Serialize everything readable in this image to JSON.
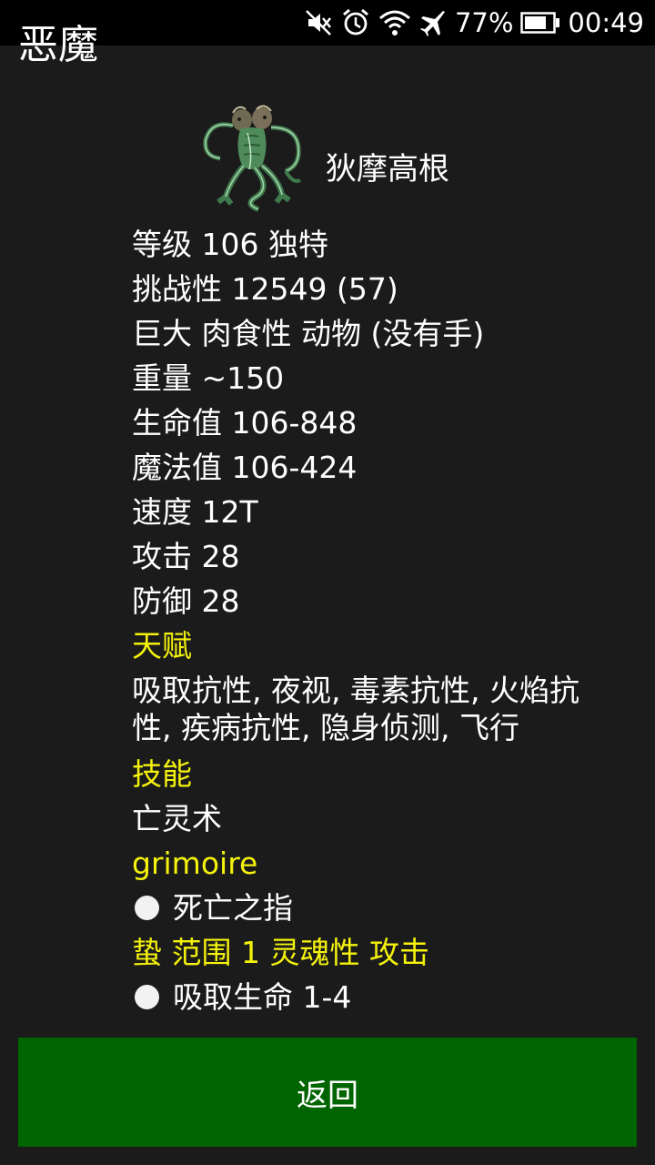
{
  "status_bar": {
    "battery": "77%",
    "time": "00:49",
    "icons": [
      "mute-icon",
      "alarm-icon",
      "wifi-icon",
      "airplane-icon",
      "battery-icon"
    ]
  },
  "title": "恶魔",
  "monster": {
    "name": "狄摩高根",
    "portrait_icon": "demogorgon-portrait"
  },
  "stats": {
    "level": "等级 106 独特",
    "challenge": "挑战性 12549 (57)",
    "size": "巨大 肉食性 动物 (没有手)",
    "weight": "重量 ~150",
    "hp": "生命值 106-848",
    "mp": "魔法值 106-424",
    "speed": "速度 12T",
    "attack": "攻击 28",
    "defense": "防御 28"
  },
  "talents": {
    "heading": "天赋",
    "text": "吸取抗性, 夜视, 毒素抗性, 火焰抗性, 疾病抗性, 隐身侦测, 飞行"
  },
  "skills": {
    "heading": "技能",
    "text": "亡灵术"
  },
  "grimoire": {
    "heading": "grimoire",
    "spell": "死亡之指"
  },
  "attack_section": {
    "heading": "蛰 范围 1 灵魂性 攻击",
    "effect": "吸取生命 1-4"
  },
  "back_button": "返回",
  "colors": {
    "background": "#1b1b1b",
    "heading": "#f5f20c",
    "button": "#006400",
    "text": "#ffffff"
  }
}
